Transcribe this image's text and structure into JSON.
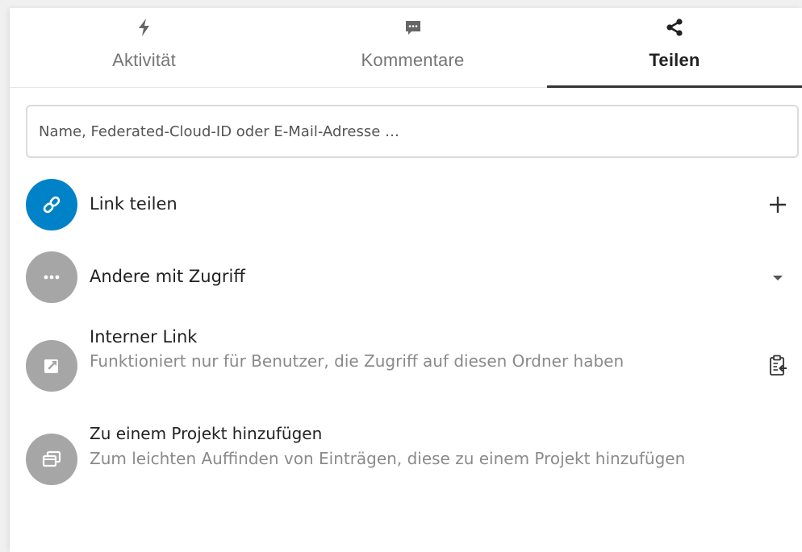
{
  "tabs": [
    {
      "label": "Aktivität",
      "icon": "lightning-icon",
      "active": false
    },
    {
      "label": "Kommentare",
      "icon": "comment-icon",
      "active": false
    },
    {
      "label": "Teilen",
      "icon": "share-icon",
      "active": true
    }
  ],
  "search": {
    "placeholder": "Name, Federated-Cloud-ID oder E-Mail-Adresse …",
    "value": ""
  },
  "share_link": {
    "title": "Link teilen",
    "icon": "link-icon",
    "action_icon": "plus-icon",
    "color": "#0082c9"
  },
  "others_access": {
    "title": "Andere mit Zugriff",
    "icon": "more-dots-icon",
    "action_icon": "caret-down-icon"
  },
  "internal_link": {
    "title": "Interner Link",
    "subtitle": "Funktioniert nur für Benutzer, die Zugriff auf diesen Ordner haben",
    "icon": "external-link-icon",
    "action_icon": "clipboard-icon"
  },
  "project": {
    "title": "Zu einem Projekt hinzufügen",
    "subtitle": "Zum leichten Auffinden von Einträgen, diese zu einem Projekt hinzufügen",
    "icon": "project-icon"
  },
  "colors": {
    "accent": "#0082c9",
    "avatar_grey": "#a6a6a6",
    "muted_text": "#8a8a8a"
  }
}
